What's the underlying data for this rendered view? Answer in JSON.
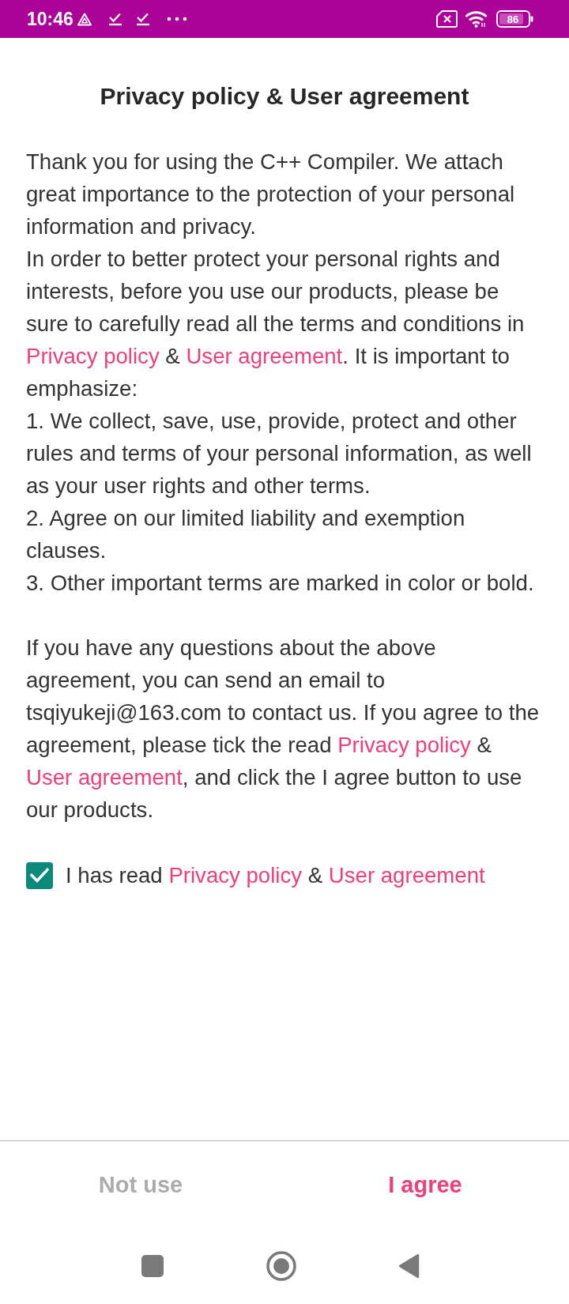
{
  "status_bar": {
    "time": "10:46",
    "battery": "86"
  },
  "dialog": {
    "title": "Privacy policy & User agreement",
    "blocks": [
      {
        "paragraphs": [
          [
            {
              "kind": "text",
              "text": "Thank you for using the C++ Compiler. We attach great importance to the protection of your personal information and privacy."
            }
          ],
          [
            {
              "kind": "text",
              "text": "In order to better protect your personal rights and interests, before you use our products, please be sure to carefully read all the terms and conditions in "
            },
            {
              "kind": "link",
              "text": "Privacy policy"
            },
            {
              "kind": "text",
              "text": " & "
            },
            {
              "kind": "link",
              "text": "User agreement"
            },
            {
              "kind": "text",
              "text": ". It is important to emphasize:"
            }
          ],
          [
            {
              "kind": "text",
              "text": "1. We collect, save, use, provide, protect and other rules and terms of your personal information, as well as your user rights and other terms."
            }
          ],
          [
            {
              "kind": "text",
              "text": "2. Agree on our limited liability and exemption clauses."
            }
          ],
          [
            {
              "kind": "text",
              "text": "3. Other important terms are marked in color or bold."
            }
          ]
        ]
      },
      {
        "paragraphs": [
          [
            {
              "kind": "text",
              "text": "If you have any questions about the above agreement, you can send an email to tsqiyukeji@163.com to contact us. If you agree to the agreement, please tick the read "
            },
            {
              "kind": "link",
              "text": "Privacy policy"
            },
            {
              "kind": "text",
              "text": " & "
            },
            {
              "kind": "link",
              "text": "User agreement"
            },
            {
              "kind": "text",
              "text": ", and click the I agree button to use our products."
            }
          ]
        ]
      }
    ],
    "consent": {
      "checked": true,
      "label": [
        {
          "kind": "text",
          "text": "I has read "
        },
        {
          "kind": "link",
          "text": "Privacy policy"
        },
        {
          "kind": "text",
          "text": " & "
        },
        {
          "kind": "link",
          "text": "User agreement"
        }
      ]
    },
    "buttons": [
      {
        "label": "Not use",
        "kind": "decline"
      },
      {
        "label": "I agree",
        "kind": "accept"
      }
    ]
  }
}
